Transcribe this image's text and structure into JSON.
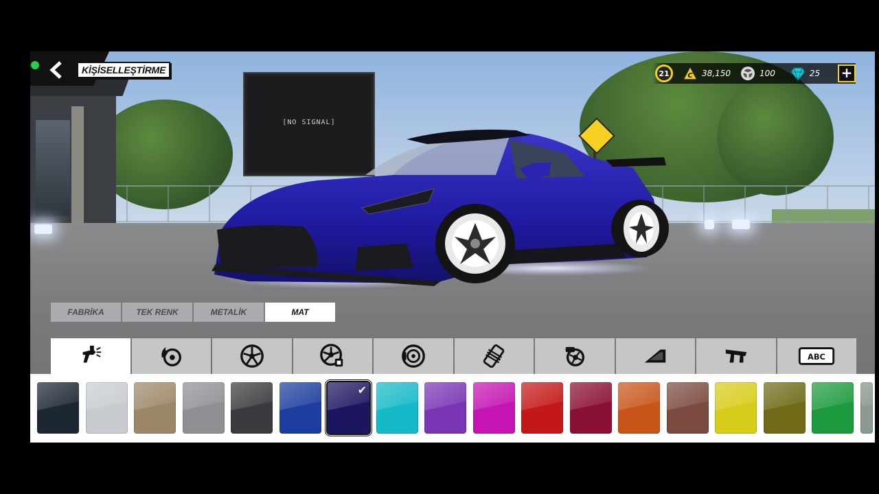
{
  "header": {
    "title": "KİŞİSELLEŞTİRME"
  },
  "currency": {
    "level": "21",
    "coins": "38,150",
    "tokens": "100",
    "gems": "25",
    "plus_label": "+"
  },
  "scene": {
    "billboard_text": "[NO SIGNAL]",
    "car_color": "#1f1aa0"
  },
  "paint_tabs": [
    {
      "label": "FABRİKA",
      "active": false
    },
    {
      "label": "TEK RENK",
      "active": false
    },
    {
      "label": "METALİK",
      "active": false
    },
    {
      "label": "MAT",
      "active": true
    }
  ],
  "categories": [
    {
      "icon": "spray-gun-icon",
      "active": true
    },
    {
      "icon": "flame-wheel-icon",
      "active": false
    },
    {
      "icon": "wheel-icon",
      "active": false
    },
    {
      "icon": "wheel-paint-icon",
      "active": false
    },
    {
      "icon": "brake-disc-icon",
      "active": false
    },
    {
      "icon": "tire-tread-icon",
      "active": false
    },
    {
      "icon": "engine-turbo-icon",
      "active": false
    },
    {
      "icon": "window-tint-icon",
      "active": false
    },
    {
      "icon": "spoiler-icon",
      "active": false
    },
    {
      "icon": "license-plate-icon",
      "active": false
    }
  ],
  "plate_label": "ABC",
  "swatches": [
    {
      "color": "#1d2733",
      "selected": false
    },
    {
      "color": "#c8ccd0",
      "selected": false
    },
    {
      "color": "#9c8868",
      "selected": false
    },
    {
      "color": "#8e9094",
      "selected": false
    },
    {
      "color": "#3a3b3e",
      "selected": false
    },
    {
      "color": "#1d3e9e",
      "selected": false
    },
    {
      "color": "#1c1660",
      "selected": true
    },
    {
      "color": "#16b9c8",
      "selected": false
    },
    {
      "color": "#7a35b5",
      "selected": false
    },
    {
      "color": "#c414b2",
      "selected": false
    },
    {
      "color": "#c41818",
      "selected": false
    },
    {
      "color": "#8a1034",
      "selected": false
    },
    {
      "color": "#c8551a",
      "selected": false
    },
    {
      "color": "#7c4b40",
      "selected": false
    },
    {
      "color": "#d8cc1a",
      "selected": false
    },
    {
      "color": "#6e6a18",
      "selected": false
    },
    {
      "color": "#1e9a3e",
      "selected": false
    }
  ]
}
